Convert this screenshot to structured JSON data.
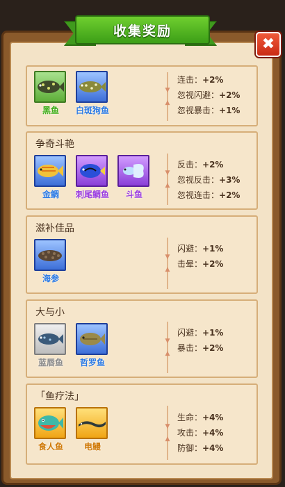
{
  "title": "收集奖励",
  "close_label": "✖",
  "sets": [
    {
      "title": "",
      "fish": [
        {
          "name": "黑鱼",
          "rarity": "green",
          "icon": "snakehead-fish-icon"
        },
        {
          "name": "白斑狗鱼",
          "rarity": "blue",
          "icon": "pike-fish-icon"
        }
      ],
      "bonuses": [
        {
          "label": "连击：",
          "value": "+2%"
        },
        {
          "label": "忽视闪避：",
          "value": "+2%"
        },
        {
          "label": "忽视暴击：",
          "value": "+1%"
        }
      ]
    },
    {
      "title": "争奇斗艳",
      "fish": [
        {
          "name": "金鲷",
          "rarity": "blue",
          "icon": "golden-bream-icon"
        },
        {
          "name": "刺尾鲷鱼",
          "rarity": "purple",
          "icon": "blue-tang-icon"
        },
        {
          "name": "斗鱼",
          "rarity": "purple",
          "icon": "betta-fish-icon"
        }
      ],
      "bonuses": [
        {
          "label": "反击：",
          "value": "+2%"
        },
        {
          "label": "忽视反击：",
          "value": "+3%"
        },
        {
          "label": "忽视连击：",
          "value": "+2%"
        }
      ]
    },
    {
      "title": "滋补佳品",
      "fish": [
        {
          "name": "海参",
          "rarity": "blue",
          "icon": "sea-cucumber-icon"
        }
      ],
      "bonuses": [
        {
          "label": "闪避：",
          "value": "+1%"
        },
        {
          "label": "击晕：",
          "value": "+2%"
        }
      ]
    },
    {
      "title": "大与小",
      "fish": [
        {
          "name": "蓝唇鱼",
          "rarity": "gray",
          "icon": "blue-lip-fish-icon"
        },
        {
          "name": "哲罗鱼",
          "rarity": "blue",
          "icon": "taimen-fish-icon"
        }
      ],
      "bonuses": [
        {
          "label": "闪避：",
          "value": "+1%"
        },
        {
          "label": "暴击：",
          "value": "+2%"
        }
      ]
    },
    {
      "title": "「鱼疗法」",
      "fish": [
        {
          "name": "食人鱼",
          "rarity": "gold",
          "icon": "piranha-icon"
        },
        {
          "name": "电鳗",
          "rarity": "gold",
          "icon": "electric-eel-icon"
        }
      ],
      "bonuses": [
        {
          "label": "生命：",
          "value": "+4%"
        },
        {
          "label": "攻击：",
          "value": "+4%"
        },
        {
          "label": "防御：",
          "value": "+4%"
        }
      ]
    }
  ],
  "colors": {
    "ribbon": "#3c9e17",
    "frame": "#8a5a2b",
    "close": "#c92a14"
  }
}
